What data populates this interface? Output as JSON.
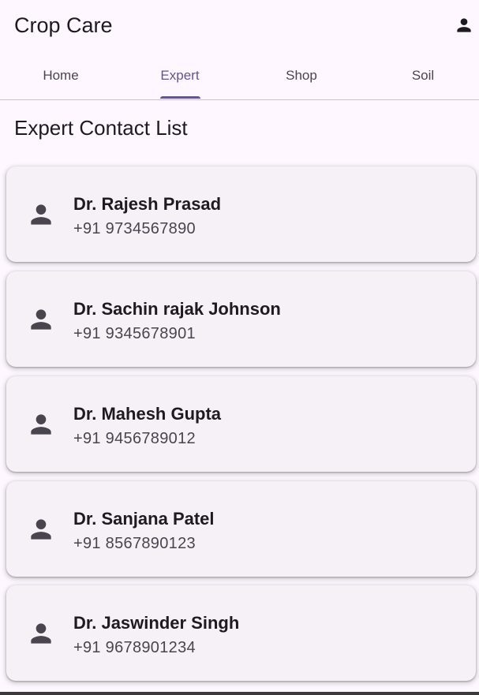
{
  "app": {
    "title": "Crop Care",
    "account_icon": "person-icon"
  },
  "tabs": [
    {
      "label": "Home",
      "active": false
    },
    {
      "label": "Expert",
      "active": true
    },
    {
      "label": "Shop",
      "active": false
    },
    {
      "label": "Soil",
      "active": false
    }
  ],
  "colors": {
    "background": "#fef7ff",
    "accent": "#65558f",
    "card": "#f5f1f7",
    "text": "#1d1b20",
    "secondary_text": "#49454f"
  },
  "section": {
    "title": "Expert Contact List"
  },
  "contacts": [
    {
      "name": "Dr. Rajesh Prasad",
      "phone": "+91 9734567890",
      "icon": "person-icon"
    },
    {
      "name": "Dr. Sachin rajak Johnson",
      "phone": "+91 9345678901",
      "icon": "person-icon"
    },
    {
      "name": "Dr. Mahesh Gupta",
      "phone": "+91 9456789012",
      "icon": "person-icon"
    },
    {
      "name": "Dr. Sanjana Patel",
      "phone": "+91 8567890123",
      "icon": "person-icon"
    },
    {
      "name": "Dr. Jaswinder Singh",
      "phone": "+91 9678901234",
      "icon": "person-icon"
    }
  ]
}
